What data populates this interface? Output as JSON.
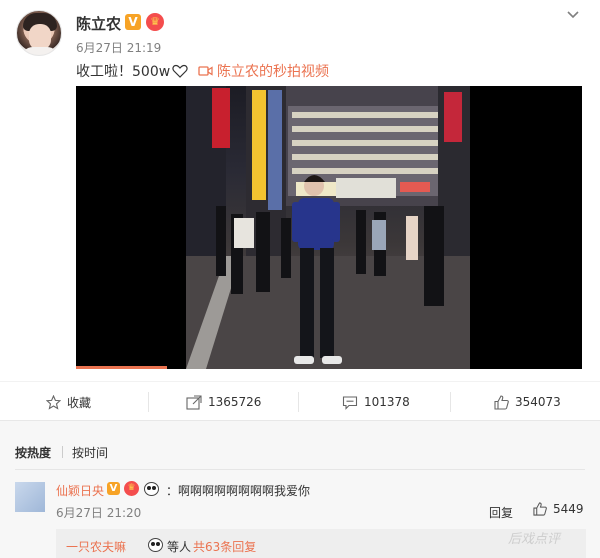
{
  "post": {
    "username": "陈立农",
    "time": "6月27日 21:19",
    "text": "收工啦！500w",
    "video_link": "陈立农的秒拍视频",
    "video_progress": 0.18
  },
  "actions": {
    "favorite": "收藏",
    "repost": "1365726",
    "comment": "101378",
    "like": "354073"
  },
  "comments": {
    "sort_hot": "按热度",
    "sort_time": "按时间",
    "items": [
      {
        "user": "仙颖日央",
        "text": "：啊啊啊啊啊啊啊啊我爱你",
        "time": "6月27日 21:20",
        "reply_label": "回复",
        "likes": "5449",
        "sub": {
          "user": "一只农夫嘛",
          "text": "等人",
          "link": "共63条回复"
        }
      }
    ]
  },
  "watermark": "后戏点评",
  "colors": {
    "accent": "#eb7350",
    "badge_v": "#f7a326",
    "badge_crown": "#f44d4d"
  }
}
